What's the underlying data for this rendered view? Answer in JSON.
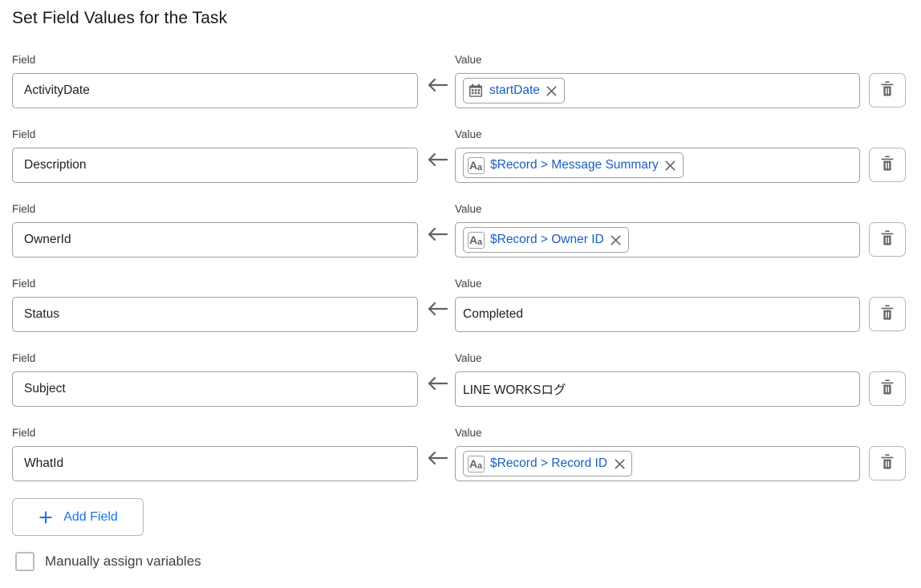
{
  "page": {
    "title": "Set Field Values for the Task",
    "field_label": "Field",
    "value_label": "Value"
  },
  "rows": [
    {
      "field": "ActivityDate",
      "arrow_icon": "arrow-left-icon",
      "delete_icon": "trash-icon",
      "value": {
        "kind": "pill",
        "icon": "calendar-icon",
        "text": "startDate",
        "remove_icon": "close-icon"
      }
    },
    {
      "field": "Description",
      "arrow_icon": "arrow-left-icon",
      "delete_icon": "trash-icon",
      "value": {
        "kind": "pill",
        "icon": "text-type-icon",
        "text": "$Record > Message Summary",
        "remove_icon": "close-icon"
      }
    },
    {
      "field": "OwnerId",
      "arrow_icon": "arrow-left-icon",
      "delete_icon": "trash-icon",
      "value": {
        "kind": "pill",
        "icon": "text-type-icon",
        "text": "$Record > Owner ID",
        "remove_icon": "close-icon"
      }
    },
    {
      "field": "Status",
      "arrow_icon": "arrow-left-icon",
      "delete_icon": "trash-icon",
      "value": {
        "kind": "text",
        "text": "Completed"
      }
    },
    {
      "field": "Subject",
      "arrow_icon": "arrow-left-icon",
      "delete_icon": "trash-icon",
      "value": {
        "kind": "text",
        "text": "LINE WORKSログ"
      }
    },
    {
      "field": "WhatId",
      "arrow_icon": "arrow-left-icon",
      "delete_icon": "trash-icon",
      "value": {
        "kind": "pill",
        "icon": "text-type-icon",
        "text": "$Record > Record ID",
        "remove_icon": "close-icon"
      }
    }
  ],
  "add_field": {
    "label": "Add Field",
    "icon": "plus-icon"
  },
  "manual_assign": {
    "label": "Manually assign variables",
    "checked": false
  },
  "colors": {
    "link": "#1a73e8",
    "pill_text": "#1a5fc0",
    "border": "#9aa0a6",
    "text": "#202124"
  }
}
